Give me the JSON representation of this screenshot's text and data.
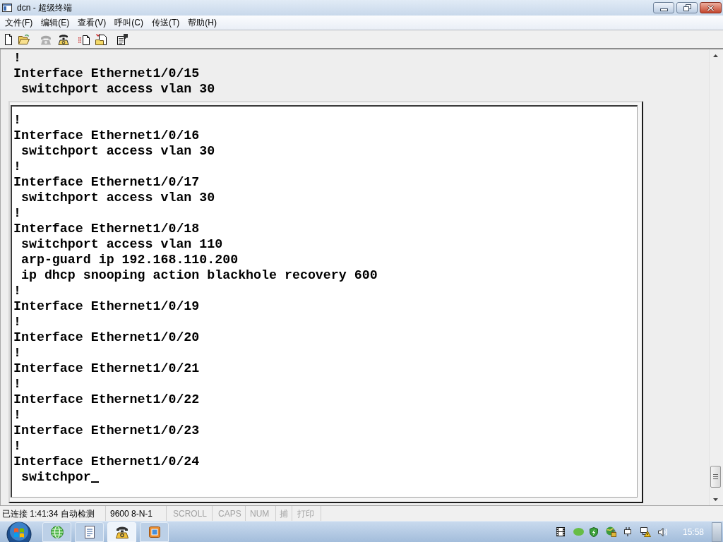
{
  "window": {
    "title": "dcn - 超级终端"
  },
  "menu_bar": [
    "文件(F)",
    "编辑(E)",
    "查看(V)",
    "呼叫(C)",
    "传送(T)",
    "帮助(H)"
  ],
  "toolbar": [
    {
      "kind": "new",
      "disabled": false
    },
    {
      "kind": "open",
      "disabled": false
    },
    {
      "kind": "connect",
      "disabled": true
    },
    {
      "kind": "disconnect",
      "disabled": false
    },
    {
      "kind": "send",
      "disabled": false
    },
    {
      "kind": "receive",
      "disabled": false
    },
    {
      "kind": "properties",
      "disabled": false
    }
  ],
  "terminal": {
    "scrollback_lines": [
      "!",
      "Interface Ethernet1/0/15",
      " switchport access vlan 30"
    ],
    "screen_lines": [
      "!",
      "Interface Ethernet1/0/16",
      " switchport access vlan 30",
      "!",
      "Interface Ethernet1/0/17",
      " switchport access vlan 30",
      "!",
      "Interface Ethernet1/0/18",
      " switchport access vlan 110",
      " arp-guard ip 192.168.110.200",
      " ip dhcp snooping action blackhole recovery 600",
      "!",
      "Interface Ethernet1/0/19",
      "!",
      "Interface Ethernet1/0/20",
      "!",
      "Interface Ethernet1/0/21",
      "!",
      "Interface Ethernet1/0/22",
      "!",
      "Interface Ethernet1/0/23",
      "!",
      "Interface Ethernet1/0/24",
      " switchpor"
    ],
    "cursor": true
  },
  "status_bar": [
    {
      "text": "已连接 1:41:34 自动检测",
      "disabled": false
    },
    {
      "text": "9600 8-N-1",
      "disabled": false
    },
    {
      "text": "SCROLL",
      "disabled": true
    },
    {
      "text": "CAPS",
      "disabled": true
    },
    {
      "text": "NUM",
      "disabled": true
    },
    {
      "text": "捕",
      "disabled": true
    },
    {
      "text": "打印",
      "disabled": true
    }
  ],
  "taskbar": {
    "buttons": [
      {
        "kind": "browser",
        "selected": false
      },
      {
        "kind": "document",
        "selected": false
      },
      {
        "kind": "terminal",
        "selected": true
      },
      {
        "kind": "window",
        "selected": false
      }
    ],
    "clock": "15:58"
  }
}
